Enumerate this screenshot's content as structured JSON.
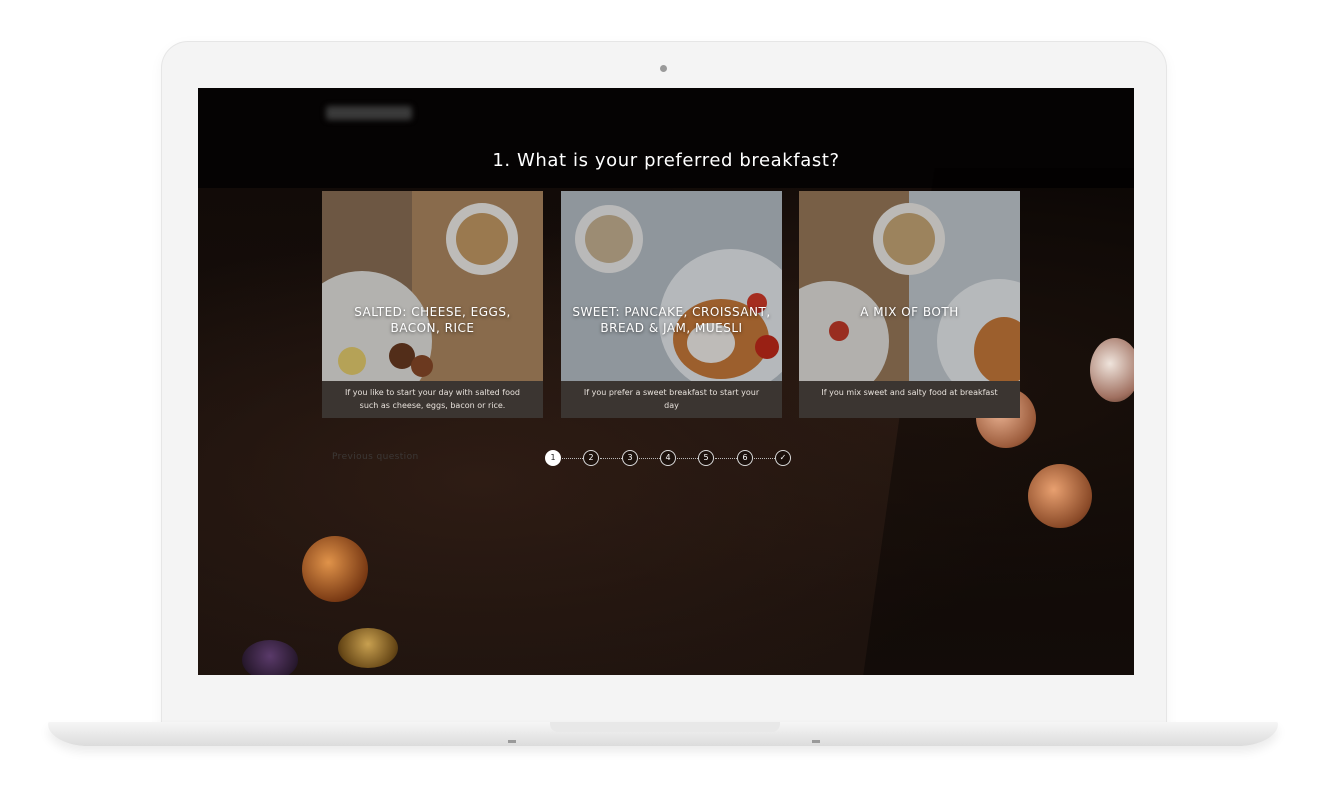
{
  "quiz": {
    "question": "1. What is your preferred breakfast?",
    "options": [
      {
        "title": "SALTED: CHEESE, EGGS, BACON, RICE",
        "description": "If you like to start your day with salted food such as cheese, eggs, bacon or rice."
      },
      {
        "title": "SWEET: PANCAKE, CROISSANT, BREAD & JAM, MUESLI",
        "description": "If you prefer a sweet breakfast to start your day"
      },
      {
        "title": "A MIX OF BOTH",
        "description": "If you mix sweet and salty food at breakfast"
      }
    ],
    "previous_label": "Previous question",
    "steps": [
      "1",
      "2",
      "3",
      "4",
      "5",
      "6",
      "✓"
    ],
    "current_step": 1
  },
  "colors": {
    "screen_bg": "#050303",
    "card_caption_bg": "#3b3531",
    "active_step": "#ffffff"
  }
}
